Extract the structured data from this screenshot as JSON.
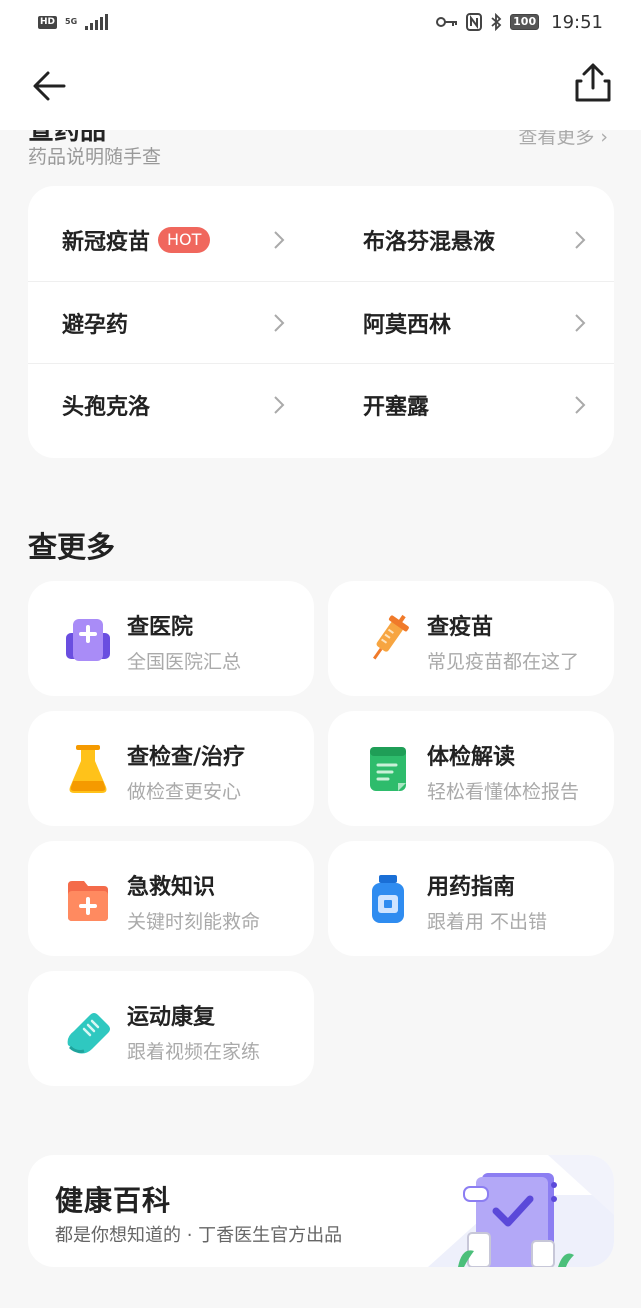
{
  "status_bar": {
    "hd": "HD",
    "network": "5G",
    "battery": "100",
    "time": "19:51"
  },
  "nav": {
    "back_icon": "arrow-left-icon",
    "share_icon": "share-icon"
  },
  "drug_section": {
    "title": "查药品",
    "subtitle": "药品说明随手查",
    "more": "查看更多 ›",
    "items": [
      {
        "name": "新冠疫苗",
        "badge": "HOT"
      },
      {
        "name": "布洛芬混悬液"
      },
      {
        "name": "避孕药"
      },
      {
        "name": "阿莫西林"
      },
      {
        "name": "头孢克洛"
      },
      {
        "name": "开塞露"
      }
    ]
  },
  "more_section": {
    "title": "查更多",
    "tiles": [
      {
        "title": "查医院",
        "subtitle": "全国医院汇总",
        "icon": "hospital-icon",
        "color": "#8b6cf0"
      },
      {
        "title": "查疫苗",
        "subtitle": "常见疫苗都在这了",
        "icon": "syringe-icon",
        "color": "#f59b3b"
      },
      {
        "title": "查检查/治疗",
        "subtitle": "做检查更安心",
        "icon": "flask-icon",
        "color": "#f5b400"
      },
      {
        "title": "体检解读",
        "subtitle": "轻松看懂体检报告",
        "icon": "report-icon",
        "color": "#2ebc6c"
      },
      {
        "title": "急救知识",
        "subtitle": "关键时刻能救命",
        "icon": "first-aid-icon",
        "color": "#f46b4a"
      },
      {
        "title": "用药指南",
        "subtitle": "跟着用 不出错",
        "icon": "medicine-bottle-icon",
        "color": "#2f8cf0"
      },
      {
        "title": "运动康复",
        "subtitle": "跟着视频在家练",
        "icon": "sneaker-icon",
        "color": "#2fc8c0"
      }
    ]
  },
  "wiki": {
    "title": "健康百科",
    "subtitle": "都是你想知道的 · 丁香医生官方出品"
  }
}
